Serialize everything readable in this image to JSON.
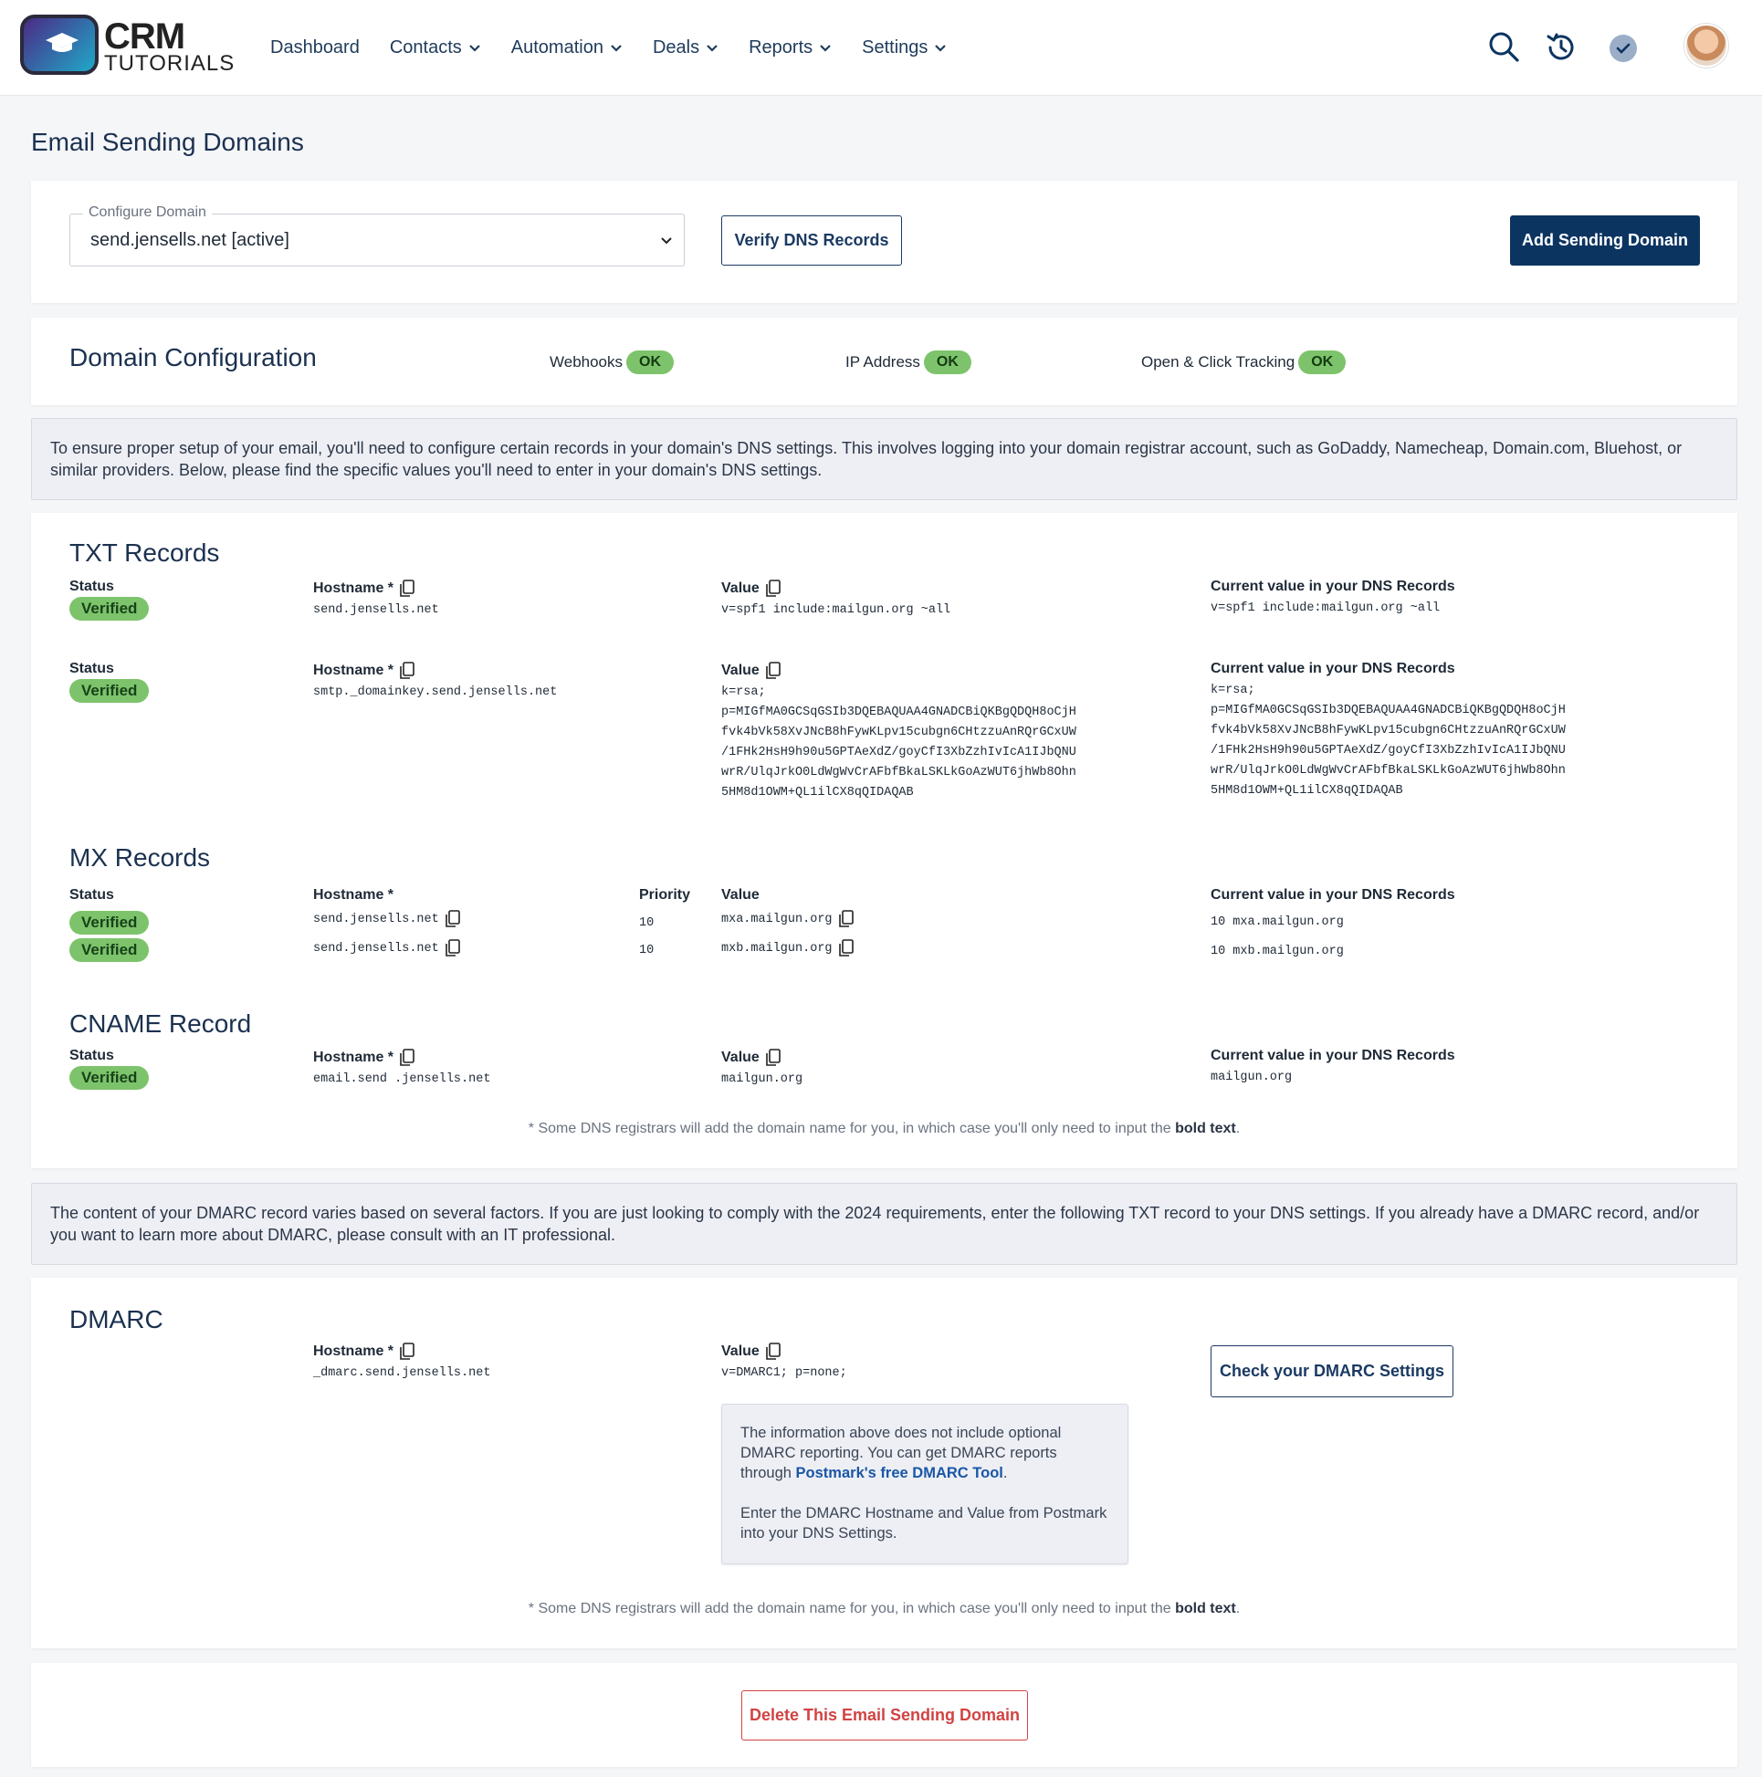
{
  "app": {
    "logo_line1": "CRM",
    "logo_line2": "TUTORIALS",
    "nav": [
      {
        "label": "Dashboard",
        "dropdown": false
      },
      {
        "label": "Contacts",
        "dropdown": true
      },
      {
        "label": "Automation",
        "dropdown": true
      },
      {
        "label": "Deals",
        "dropdown": true
      },
      {
        "label": "Reports",
        "dropdown": true
      },
      {
        "label": "Settings",
        "dropdown": true
      }
    ],
    "icons": [
      "search-icon",
      "history-icon",
      "check-circle-icon",
      "avatar"
    ],
    "accent": "#0c3461",
    "ok_color": "#7dc36b",
    "danger_color": "#d14343"
  },
  "page": {
    "title": "Email Sending Domains"
  },
  "domain": {
    "legend": "Configure Domain",
    "selected": "send.jensells.net [active]",
    "verify_label": "Verify DNS Records",
    "add_label": "Add Sending Domain"
  },
  "config": {
    "title": "Domain Configuration",
    "statuses": [
      {
        "label": "Webhooks",
        "status": "OK"
      },
      {
        "label": "IP Address",
        "status": "OK"
      },
      {
        "label": "Open & Click Tracking",
        "status": "OK"
      }
    ]
  },
  "info1": "To ensure proper setup of your email, you'll need to configure certain records in your domain's DNS settings. This involves logging into your domain registrar account, such as GoDaddy, Namecheap, Domain.com, Bluehost, or similar providers. Below, please find the specific values you'll need to enter in your domain's DNS settings.",
  "labels": {
    "status": "Status",
    "hostname": "Hostname *",
    "value": "Value",
    "priority": "Priority",
    "current": "Current value in your DNS Records"
  },
  "txt": {
    "title": "TXT Records",
    "records": [
      {
        "status": "Verified",
        "hostname": "send.jensells.net",
        "value": "v=spf1 include:mailgun.org ~all",
        "current": "v=spf1 include:mailgun.org ~all"
      },
      {
        "status": "Verified",
        "hostname": "smtp._domainkey.send.jensells.net",
        "value": "k=rsa;\np=MIGfMA0GCSqGSIb3DQEBAQUAA4GNADCBiQKBgQDQH8oCjH\nfvk4bVk58XvJNcB8hFywKLpv15cubgn6CHtzzuAnRQrGCxUW\n/1FHk2HsH9h90u5GPTAeXdZ/goyCfI3XbZzhIvIcA1IJbQNU\nwrR/UlqJrkO0LdWgWvCrAFbfBkaLSKLkGoAzWUT6jhWb8Ohn\n5HM8d1OWM+QL1ilCX8qQIDAQAB",
        "current": "k=rsa;\np=MIGfMA0GCSqGSIb3DQEBAQUAA4GNADCBiQKBgQDQH8oCjH\nfvk4bVk58XvJNcB8hFywKLpv15cubgn6CHtzzuAnRQrGCxUW\n/1FHk2HsH9h90u5GPTAeXdZ/goyCfI3XbZzhIvIcA1IJbQNU\nwrR/UlqJrkO0LdWgWvCrAFbfBkaLSKLkGoAzWUT6jhWb8Ohn\n5HM8d1OWM+QL1ilCX8qQIDAQAB"
      }
    ]
  },
  "mx": {
    "title": "MX Records",
    "records": [
      {
        "status": "Verified",
        "hostname": "send.jensells.net",
        "priority": "10",
        "value": "mxa.mailgun.org",
        "current": "10 mxa.mailgun.org"
      },
      {
        "status": "Verified",
        "hostname": "send.jensells.net",
        "priority": "10",
        "value": "mxb.mailgun.org",
        "current": "10 mxb.mailgun.org"
      }
    ]
  },
  "cname": {
    "title": "CNAME Record",
    "record": {
      "status": "Verified",
      "hostname": "email.send .jensells.net",
      "value": "mailgun.org",
      "current": "mailgun.org"
    }
  },
  "note": {
    "prefix": "* Some DNS registrars will add the domain name for you, in which case you'll only need to input the ",
    "bold": "bold text",
    "suffix": "."
  },
  "info2": "The content of your DMARC record varies based on several factors. If you are just looking to comply with the 2024 requirements, enter the following TXT record to your DNS settings. If you already have a DMARC record, and/or you want to learn more about DMARC, please consult with an IT professional.",
  "dmarc": {
    "title": "DMARC",
    "hostname": "_dmarc.send.jensells.net",
    "value": "v=DMARC1; p=none;",
    "check_label": "Check your DMARC Settings",
    "tip_part1": "The information above does not include optional DMARC reporting. You can get DMARC reports through ",
    "tip_link": "Postmark's free DMARC Tool",
    "tip_part2": ".",
    "tip_para2": "Enter the DMARC Hostname and Value from Postmark into your DNS Settings."
  },
  "delete_label": "Delete This Email Sending Domain"
}
